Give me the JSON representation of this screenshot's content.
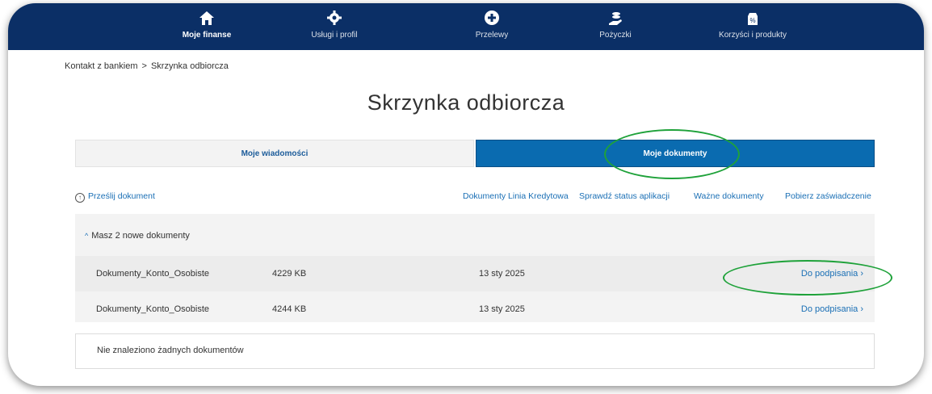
{
  "nav": {
    "items": [
      {
        "label": "Moje finanse",
        "icon": "home-icon"
      },
      {
        "label": "Usługi i profil",
        "icon": "gear-icon"
      },
      {
        "label": "Przelewy",
        "icon": "plus-circle-icon"
      },
      {
        "label": "Pożyczki",
        "icon": "hand-coins-icon"
      },
      {
        "label": "Korzyści i produkty",
        "icon": "percent-bag-icon"
      }
    ]
  },
  "breadcrumb": {
    "parent": "Kontakt z bankiem",
    "separator": ">",
    "current": "Skrzynka odbiorcza"
  },
  "page": {
    "title": "Skrzynka odbiorcza"
  },
  "tabs": {
    "messages": "Moje wiadomości",
    "documents": "Moje dokumenty"
  },
  "actions": {
    "upload": "Prześlij dokument",
    "credit_line_docs": "Dokumenty Linia Kredytowa",
    "check_status": "Sprawdź status aplikacji",
    "important_docs": "Ważne dokumenty",
    "certificate": "Pobierz zaświadczenie"
  },
  "new_docs": {
    "header": "Masz 2 nowe dokumenty",
    "rows": [
      {
        "name": "Dokumenty_Konto_Osobiste",
        "size": "4229 KB",
        "date": "13 sty 2025",
        "action": "Do podpisania"
      },
      {
        "name": "Dokumenty_Konto_Osobiste",
        "size": "4244 KB",
        "date": "13 sty 2025",
        "action": "Do podpisania"
      }
    ]
  },
  "empty": {
    "text": "Nie znaleziono żadnych dokumentów"
  },
  "colors": {
    "nav": "#0b2f66",
    "active_tab": "#0a6bb0",
    "link": "#1a6fb5",
    "highlight": "#1fa23a"
  }
}
